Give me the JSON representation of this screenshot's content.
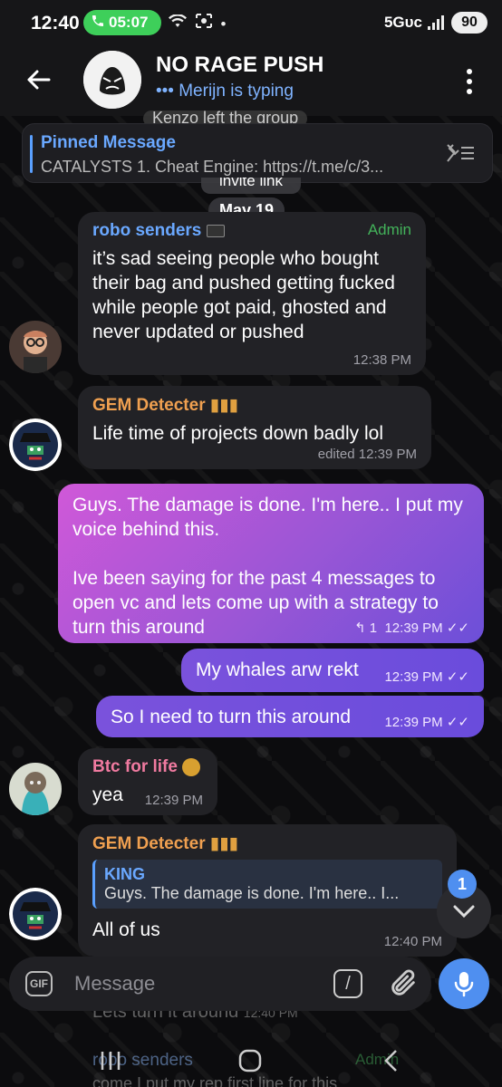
{
  "status_bar": {
    "time": "12:40",
    "call_timer": "05:07",
    "network": "5Gᴜᴄ",
    "battery": "90"
  },
  "header": {
    "title": "NO RAGE PUSH",
    "typing": "••• Merijn is typing"
  },
  "service_message": "Kenzo left the group",
  "pinned": {
    "title": "Pinned Message",
    "text": "CATALYSTS  1. Cheat Engine: https://t.me/c/3..."
  },
  "invite_link_label": "invite link",
  "date_separator": "May 19",
  "messages": [
    {
      "sender": "robo senders",
      "role": "Admin",
      "text": "it’s sad seeing people who bought their bag and pushed getting fucked while people got paid, ghosted and never updated or pushed",
      "time": "12:38 PM"
    },
    {
      "sender": "GEM Detecter",
      "text": "Life time of projects down badly lol",
      "time": "edited 12:39 PM"
    },
    {
      "text": "Guys. The damage is done. I'm here.. I put my voice behind this.\n\nIve been saying for the past 4 messages to open vc and lets come up with a strategy to turn this around",
      "replies": "1",
      "time": "12:39 PM"
    },
    {
      "text": "My whales arw rekt",
      "time": "12:39 PM"
    },
    {
      "text": "So I need to turn this around",
      "time": "12:39 PM"
    },
    {
      "sender": "Btc for life",
      "text": "yea",
      "time": "12:39 PM"
    },
    {
      "sender": "GEM Detecter",
      "reply_to_name": "KING",
      "reply_to_text": "Guys. The damage is done. I'm here.. I...",
      "text": "All of us",
      "time": "12:40 PM"
    }
  ],
  "behind_input": {
    "text": "Lets turn it around",
    "time": "12:40 PM",
    "sender": "robo senders",
    "role": "Admin",
    "snippet": "come I put my rep first line for this"
  },
  "scroll_badge": "1",
  "composer": {
    "gif_label": "GIF",
    "placeholder": "Message"
  },
  "colors": {
    "accent_blue": "#4f8ff0",
    "admin_green": "#43b25a",
    "sender_orange": "#f0a050",
    "sender_pink": "#f07aa0",
    "sender_blue": "#6aa8ff",
    "outgoing_gradient_start": "#d058d8",
    "outgoing_gradient_end": "#6c4fd8"
  }
}
